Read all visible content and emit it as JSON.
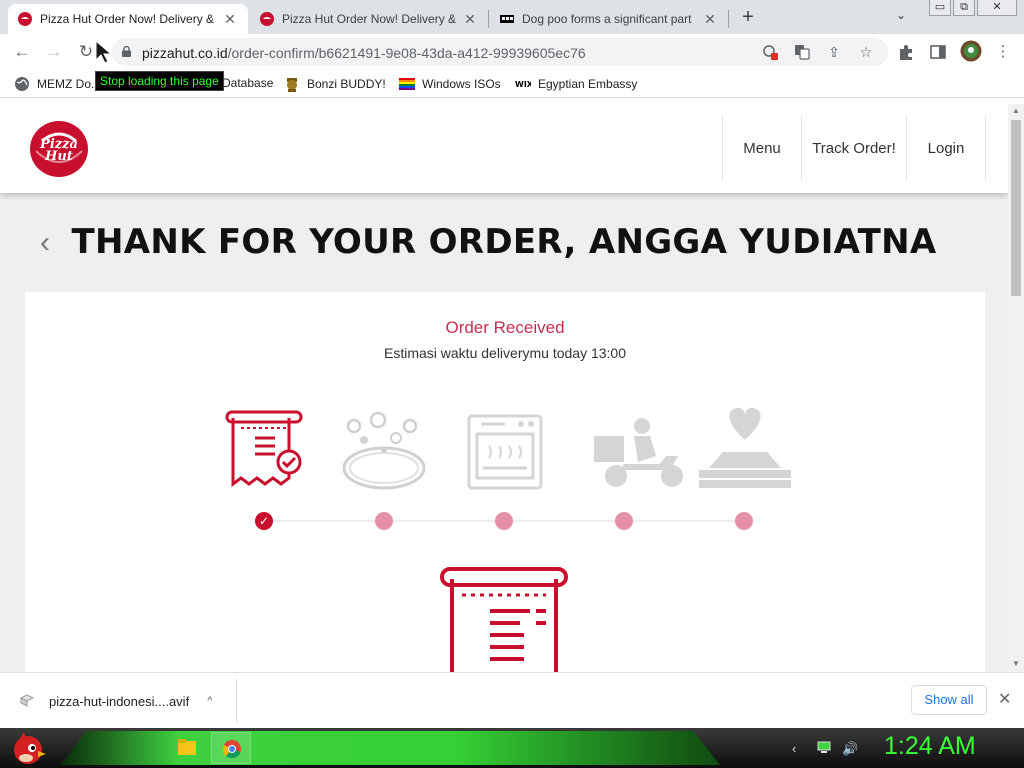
{
  "browser": {
    "tabs": [
      {
        "title": "Pizza Hut Order Now! Delivery & Takeaway",
        "active": true
      },
      {
        "title": "Pizza Hut Order Now! Delivery & Takeaway",
        "active": false
      },
      {
        "title": "Dog poo forms a significant part",
        "active": false
      }
    ],
    "new_tab_label": "+",
    "tab_search_label": "⌄",
    "window_controls": {
      "minimize": "▭",
      "restore": "⧉",
      "close": "✕"
    },
    "url": {
      "domain": "pizzahut.co.id",
      "path": "/order-confirm/b6621491-9e08-43da-a412-99939605ec76"
    },
    "tooltip": "Stop loading this page",
    "bookmarks": [
      {
        "label": "MEMZ Do..."
      },
      {
        "label": "Database"
      },
      {
        "label": "Bonzi BUDDY!"
      },
      {
        "label": "Windows ISOs"
      },
      {
        "label": "Egyptian Embassy"
      }
    ]
  },
  "site": {
    "nav": [
      "Menu",
      "Track Order!",
      "Login"
    ],
    "logo_text": "Pizza Hut",
    "heading": "THANK FOR YOUR ORDER, ANGGA YUDIATNA",
    "status": "Order Received",
    "estimate": "Estimasi waktu deliverymu today 13:00",
    "steps": [
      {
        "icon": "receipt-check-icon",
        "state": "done"
      },
      {
        "icon": "pizza-prep-icon",
        "state": "pending"
      },
      {
        "icon": "oven-icon",
        "state": "pending"
      },
      {
        "icon": "delivery-scooter-icon",
        "state": "pending"
      },
      {
        "icon": "delivered-box-icon",
        "state": "pending"
      }
    ],
    "colors": {
      "brand": "#c8102e",
      "status_text": "#c03050",
      "pending_dot": "#e690a7"
    }
  },
  "downloads": {
    "file": "pizza-hut-indonesi....avif",
    "show_all": "Show all"
  },
  "taskbar": {
    "clock": "1:24 AM"
  }
}
